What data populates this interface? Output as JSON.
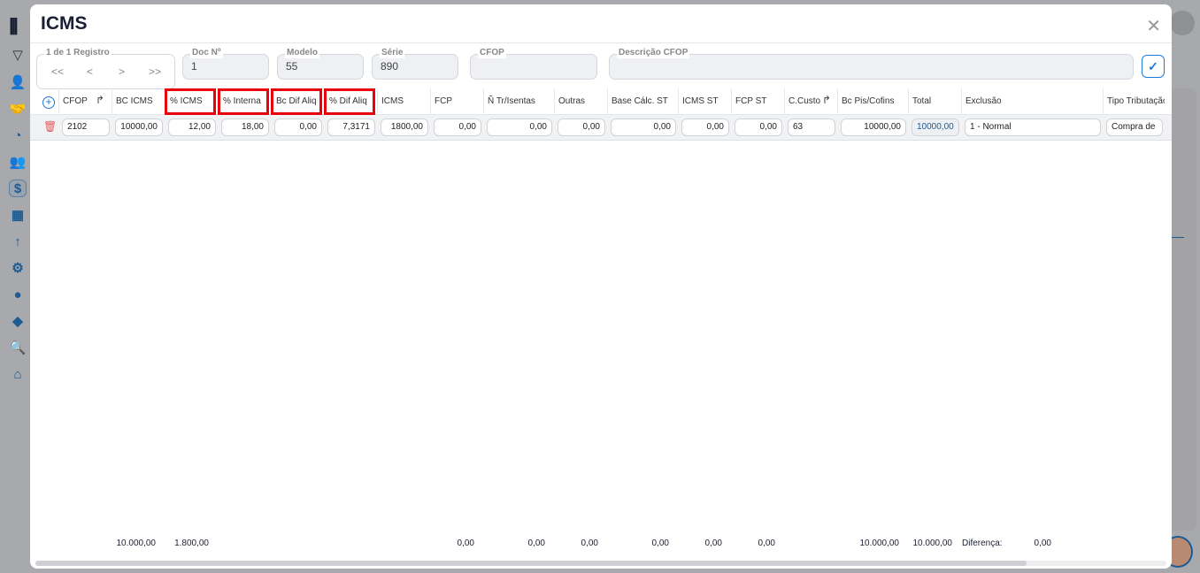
{
  "modal": {
    "title": "ICMS"
  },
  "nav": {
    "label": "1 de 1 Registro",
    "first": "<<",
    "prev": "<",
    "next": ">",
    "last": ">>"
  },
  "fields": [
    {
      "label": "Doc Nº",
      "value": "1"
    },
    {
      "label": "Modelo",
      "value": "55"
    },
    {
      "label": "Série",
      "value": "890"
    },
    {
      "label": "CFOP",
      "value": ""
    },
    {
      "label": "Descrição CFOP",
      "value": ""
    }
  ],
  "columns": [
    "CFOP",
    "BC ICMS",
    "% ICMS",
    "% Interna",
    "Bc Dif Aliq",
    "% Dif Aliq",
    "ICMS",
    "FCP",
    "Ñ Tr/Isentas",
    "Outras",
    "Base Cálc. ST",
    "ICMS ST",
    "FCP ST",
    "C.Custo",
    "Bc Pis/Cofins",
    "Total",
    "Exclusão",
    "Tipo Tributação"
  ],
  "highlighted_columns": [
    "% ICMS",
    "% Interna",
    "Bc Dif Aliq",
    "% Dif Aliq"
  ],
  "row": [
    "2102",
    "10000,00",
    "12,00",
    "18,00",
    "0,00",
    "7,3171",
    "1800,00",
    "0,00",
    "0,00",
    "0,00",
    "0,00",
    "0,00",
    "0,00",
    "63",
    "10000,00",
    "10000,00",
    "1 - Normal",
    "Compra de"
  ],
  "totals": {
    "bc_icms": "10.000,00",
    "icms": "1.800,00",
    "fcp": "0,00",
    "isentas": "0,00",
    "outras": "0,00",
    "base_st": "0,00",
    "icms_st": "0,00",
    "fcp_st": "0,00",
    "bc_pis": "10.000,00",
    "total": "10.000,00",
    "diferenca_label": "Diferença:",
    "diferenca": "0,00"
  },
  "colors": {
    "highlight": "#e8000b",
    "accent": "#1e78d8",
    "sidebar_icon": "#1d5b93"
  }
}
